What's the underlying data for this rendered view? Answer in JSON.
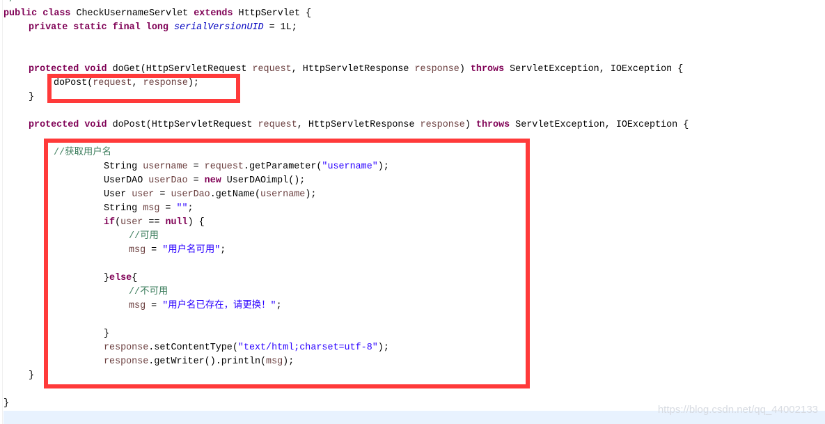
{
  "editor": {
    "lines": [
      [
        {
          "t": "*/",
          "c": "cm"
        }
      ],
      [
        {
          "t": "public",
          "c": "kw"
        },
        {
          "t": " "
        },
        {
          "t": "class",
          "c": "kw"
        },
        {
          "t": " CheckUsernameServlet "
        },
        {
          "t": "extends",
          "c": "kw"
        },
        {
          "t": " HttpServlet {"
        }
      ],
      [
        {
          "t": "",
          "i": 1
        },
        {
          "t": "private",
          "c": "kw"
        },
        {
          "t": " "
        },
        {
          "t": "static",
          "c": "kw"
        },
        {
          "t": " "
        },
        {
          "t": "final",
          "c": "kw"
        },
        {
          "t": " "
        },
        {
          "t": "long",
          "c": "kw"
        },
        {
          "t": " "
        },
        {
          "t": "serialVersionUID",
          "c": "field"
        },
        {
          "t": " = 1L;"
        }
      ],
      [],
      [],
      [
        {
          "t": "",
          "i": 1
        },
        {
          "t": "protected",
          "c": "kw"
        },
        {
          "t": " "
        },
        {
          "t": "void",
          "c": "kw"
        },
        {
          "t": " doGet(HttpServletRequest "
        },
        {
          "t": "request",
          "c": "param"
        },
        {
          "t": ", HttpServletResponse "
        },
        {
          "t": "response",
          "c": "param"
        },
        {
          "t": ") "
        },
        {
          "t": "throws",
          "c": "kw"
        },
        {
          "t": " ServletException, IOException {"
        }
      ],
      [
        {
          "t": "",
          "i": 2
        },
        {
          "t": "doPost("
        },
        {
          "t": "request",
          "c": "param"
        },
        {
          "t": ", "
        },
        {
          "t": "response",
          "c": "param"
        },
        {
          "t": ");"
        }
      ],
      [
        {
          "t": "",
          "i": 1
        },
        {
          "t": "}"
        }
      ],
      [],
      [
        {
          "t": "",
          "i": 1
        },
        {
          "t": "protected",
          "c": "kw"
        },
        {
          "t": " "
        },
        {
          "t": "void",
          "c": "kw"
        },
        {
          "t": " doPost(HttpServletRequest "
        },
        {
          "t": "request",
          "c": "param"
        },
        {
          "t": ", HttpServletResponse "
        },
        {
          "t": "response",
          "c": "param"
        },
        {
          "t": ") "
        },
        {
          "t": "throws",
          "c": "kw"
        },
        {
          "t": " ServletException, IOException {"
        }
      ],
      [],
      [
        {
          "t": "",
          "i": 2
        },
        {
          "t": "//获取用户名",
          "c": "cm"
        }
      ],
      [
        {
          "t": "",
          "i": 4
        },
        {
          "t": "String "
        },
        {
          "t": "username",
          "c": "param"
        },
        {
          "t": " = "
        },
        {
          "t": "request",
          "c": "param"
        },
        {
          "t": ".getParameter("
        },
        {
          "t": "\"username\"",
          "c": "str"
        },
        {
          "t": ");"
        }
      ],
      [
        {
          "t": "",
          "i": 4
        },
        {
          "t": "UserDAO "
        },
        {
          "t": "userDao",
          "c": "param"
        },
        {
          "t": " = "
        },
        {
          "t": "new",
          "c": "kw"
        },
        {
          "t": " UserDAOimpl();"
        }
      ],
      [
        {
          "t": "",
          "i": 4
        },
        {
          "t": "User "
        },
        {
          "t": "user",
          "c": "param"
        },
        {
          "t": " = "
        },
        {
          "t": "userDao",
          "c": "param"
        },
        {
          "t": ".getName("
        },
        {
          "t": "username",
          "c": "param"
        },
        {
          "t": ");"
        }
      ],
      [
        {
          "t": "",
          "i": 4
        },
        {
          "t": "String "
        },
        {
          "t": "msg",
          "c": "param"
        },
        {
          "t": " = "
        },
        {
          "t": "\"\"",
          "c": "str"
        },
        {
          "t": ";"
        }
      ],
      [
        {
          "t": "",
          "i": 4
        },
        {
          "t": "if",
          "c": "kw"
        },
        {
          "t": "("
        },
        {
          "t": "user",
          "c": "param"
        },
        {
          "t": " == "
        },
        {
          "t": "null",
          "c": "kw"
        },
        {
          "t": ") {"
        }
      ],
      [
        {
          "t": "",
          "i": 5
        },
        {
          "t": "//可用",
          "c": "cm"
        }
      ],
      [
        {
          "t": "",
          "i": 5
        },
        {
          "t": "msg",
          "c": "param"
        },
        {
          "t": " = "
        },
        {
          "t": "\"用户名可用\"",
          "c": "str"
        },
        {
          "t": ";"
        }
      ],
      [],
      [
        {
          "t": "",
          "i": 4
        },
        {
          "t": "}"
        },
        {
          "t": "else",
          "c": "kw"
        },
        {
          "t": "{"
        }
      ],
      [
        {
          "t": "",
          "i": 5
        },
        {
          "t": "//不可用",
          "c": "cm"
        }
      ],
      [
        {
          "t": "",
          "i": 5
        },
        {
          "t": "msg",
          "c": "param"
        },
        {
          "t": " = "
        },
        {
          "t": "\"用户名已存在，请更换！\"",
          "c": "str"
        },
        {
          "t": ";"
        }
      ],
      [],
      [
        {
          "t": "",
          "i": 4
        },
        {
          "t": "}"
        }
      ],
      [
        {
          "t": "",
          "i": 4
        },
        {
          "t": "response",
          "c": "param"
        },
        {
          "t": ".setContentType("
        },
        {
          "t": "\"text/html;charset=utf-8\"",
          "c": "str"
        },
        {
          "t": ");"
        }
      ],
      [
        {
          "t": "",
          "i": 4
        },
        {
          "t": "response",
          "c": "param"
        },
        {
          "t": ".getWriter().println("
        },
        {
          "t": "msg",
          "c": "param"
        },
        {
          "t": ");"
        }
      ],
      [
        {
          "t": "",
          "i": 1
        },
        {
          "t": "}"
        }
      ],
      [],
      [
        {
          "t": "}"
        }
      ]
    ]
  },
  "watermark": "https://blog.csdn.net/qq_44002133",
  "colors": {
    "highlight_box": "#ff3a3a",
    "keyword": "#7f0055",
    "string": "#2a00ff",
    "comment": "#3f7f5f",
    "current_line": "#e8f2fe"
  }
}
